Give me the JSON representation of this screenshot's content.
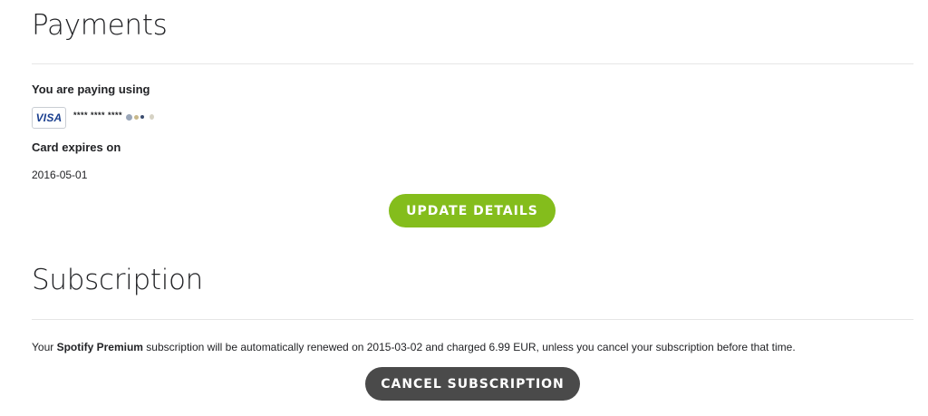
{
  "payments": {
    "title": "Payments",
    "paying_label": "You are paying using",
    "card_brand": "VISA",
    "card_number": "**** **** ****",
    "expires_label": "Card expires on",
    "expiry": "2016-05-01",
    "update_button": "UPDATE DETAILS"
  },
  "subscription": {
    "title": "Subscription",
    "text_prefix": "Your ",
    "product": "Spotify Premium",
    "text_suffix": " subscription will be automatically renewed on 2015-03-02 and charged 6.99 EUR, unless you cancel your subscription before that time.",
    "cancel_button": "CANCEL SUBSCRIPTION"
  },
  "colors": {
    "update_button": "#84bd1c",
    "cancel_button": "#4a4a4a",
    "text": "#222326",
    "visa_blue": "#1a3f8f"
  },
  "icons": {
    "card_brand_icon": "visa-card-icon"
  }
}
